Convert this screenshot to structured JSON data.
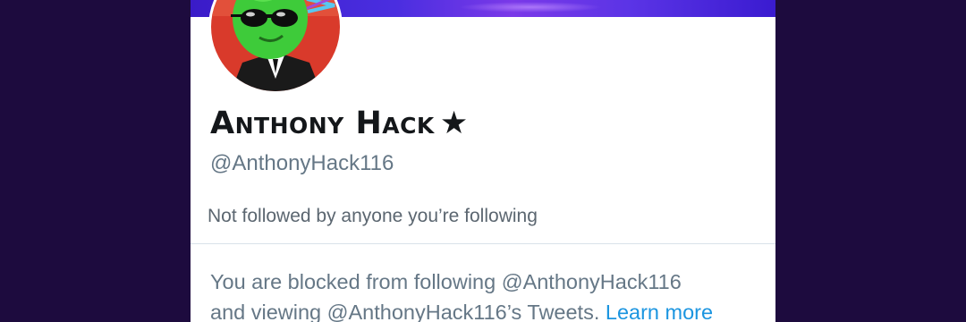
{
  "profile": {
    "display_name": "Anthony Hack",
    "badge": "★",
    "handle": "@AnthonyHack116",
    "avatar_icon": "alien-with-sunglasses-avatar"
  },
  "social_context": {
    "text": "Not followed by anyone you’re following"
  },
  "block_notice": {
    "line1": "You are blocked from following @AnthonyHack116",
    "line2": "and viewing @AnthonyHack116’s Tweets.",
    "learn_more": "Learn more"
  },
  "colors": {
    "page_background": "#1d0b3e",
    "banner": "#4a2ee0",
    "link": "#1b95e0",
    "secondary_text": "#657786"
  }
}
